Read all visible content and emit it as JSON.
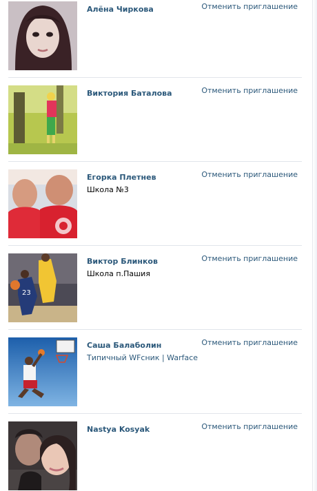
{
  "action_label": "Отменить приглашение",
  "people": [
    {
      "name": "Алёна Чиркова",
      "sub": ""
    },
    {
      "name": "Виктория Баталова",
      "sub": ""
    },
    {
      "name": "Егорка Плетнев",
      "sub": "Школа №3"
    },
    {
      "name": "Виктор Блинков",
      "sub": "Школа п.Пашия"
    },
    {
      "name": "Саша Балаболин",
      "sub": "Типичный WFсник | Warface"
    },
    {
      "name": "Nastya Kosyak",
      "sub": ""
    }
  ]
}
